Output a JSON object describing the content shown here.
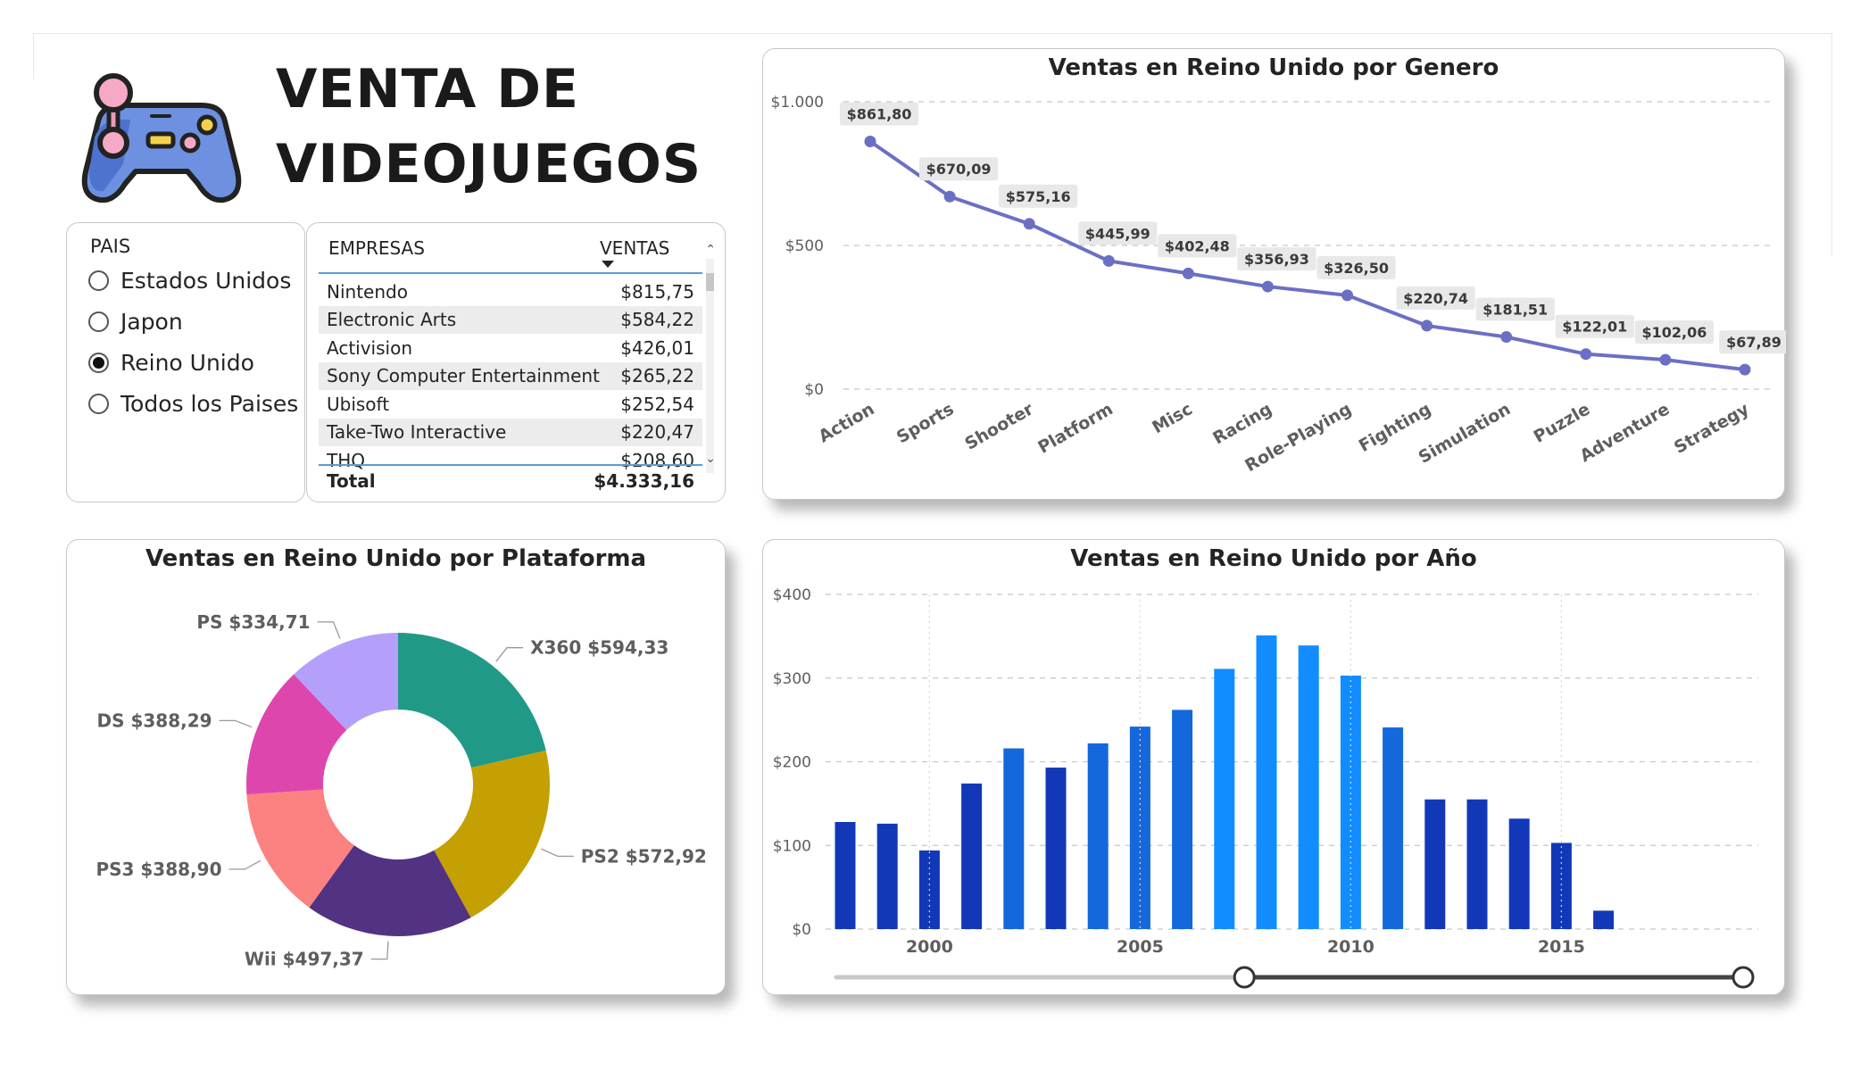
{
  "header": {
    "title_line1": "VENTA DE",
    "title_line2": "VIDEOJUEGOS",
    "logo_icon": "gamepad-icon"
  },
  "country_slicer": {
    "title": "PAIS",
    "options": [
      {
        "label": "Estados Unidos",
        "selected": false
      },
      {
        "label": "Japon",
        "selected": false
      },
      {
        "label": "Reino Unido",
        "selected": true
      },
      {
        "label": "Todos los Paises",
        "selected": false
      }
    ]
  },
  "company_table": {
    "headers": [
      "EMPRESAS",
      "VENTAS"
    ],
    "rows": [
      [
        "Nintendo",
        "$815,75"
      ],
      [
        "Electronic Arts",
        "$584,22"
      ],
      [
        "Activision",
        "$426,01"
      ],
      [
        "Sony Computer Entertainment",
        "$265,22"
      ],
      [
        "Ubisoft",
        "$252,54"
      ],
      [
        "Take-Two Interactive",
        "$220,47"
      ],
      [
        "THQ",
        "$208,60"
      ]
    ],
    "total_label": "Total",
    "total_value": "$4.333,16"
  },
  "chart_data": [
    {
      "type": "line",
      "title": "Ventas en Reino Unido por Genero",
      "categories": [
        "Action",
        "Sports",
        "Shooter",
        "Platform",
        "Misc",
        "Racing",
        "Role-Playing",
        "Fighting",
        "Simulation",
        "Puzzle",
        "Adventure",
        "Strategy"
      ],
      "values": [
        861.8,
        670.09,
        575.16,
        445.99,
        402.48,
        356.93,
        326.5,
        220.74,
        181.51,
        122.01,
        102.06,
        67.89
      ],
      "data_labels": [
        "$861,80",
        "$670,09",
        "$575,16",
        "$445,99",
        "$402,48",
        "$356,93",
        "$326,50",
        "$220,74",
        "$181,51",
        "$122,01",
        "$102,06",
        "$67,89"
      ],
      "y_ticks": [
        "$0",
        "$500",
        "$1.000"
      ],
      "ylim": [
        0,
        1000
      ],
      "grid": true,
      "color": "#6b6fc4"
    },
    {
      "type": "pie",
      "title": "Ventas en Reino Unido por Plataforma",
      "labels": [
        "X360",
        "PS2",
        "Wii",
        "PS3",
        "DS",
        "PS"
      ],
      "values": [
        594.33,
        572.92,
        497.37,
        388.9,
        388.29,
        334.71
      ],
      "data_labels": [
        "X360 $594,33",
        "PS2 $572,92",
        "Wii $497,37",
        "PS3 $388,90",
        "DS $388,29",
        "PS $334,71"
      ],
      "colors": [
        "#209a86",
        "#c4a002",
        "#523282",
        "#fc8181",
        "#dd47ad",
        "#b4a0fa"
      ],
      "donut": true
    },
    {
      "type": "bar",
      "title": "Ventas en Reino Unido por Año",
      "x": [
        1998,
        1999,
        2000,
        2001,
        2002,
        2003,
        2004,
        2005,
        2006,
        2007,
        2008,
        2009,
        2010,
        2011,
        2012,
        2013,
        2014,
        2015,
        2016
      ],
      "values": [
        128,
        126,
        94,
        174,
        216,
        193,
        222,
        242,
        262,
        311,
        351,
        339,
        303,
        241,
        155,
        155,
        132,
        103,
        22
      ],
      "x_ticks": [
        "2000",
        "2005",
        "2010",
        "2015"
      ],
      "y_ticks": [
        "$0",
        "$100",
        "$200",
        "$300",
        "$400"
      ],
      "ylim": [
        0,
        400
      ],
      "grid": true,
      "range_slider": {
        "min": 1980,
        "max": 2020,
        "from": 1998,
        "to": 2020
      }
    }
  ]
}
